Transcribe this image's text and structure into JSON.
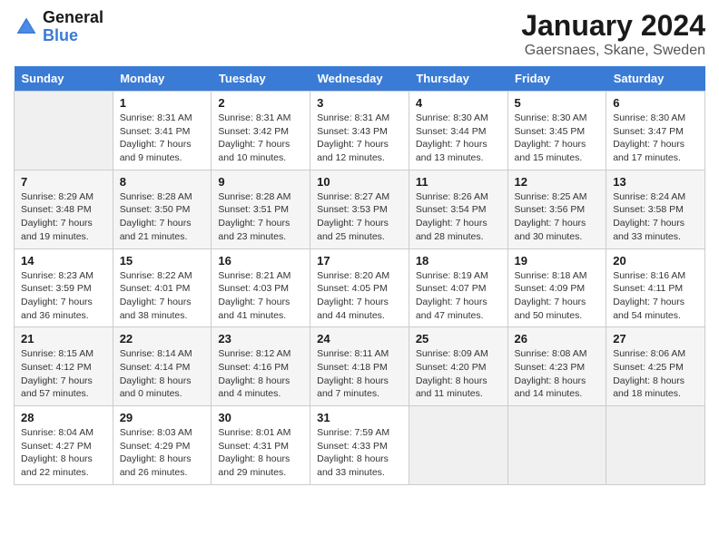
{
  "header": {
    "logo_text_general": "General",
    "logo_text_blue": "Blue",
    "month_title": "January 2024",
    "location": "Gaersnaes, Skane, Sweden"
  },
  "days_of_week": [
    "Sunday",
    "Monday",
    "Tuesday",
    "Wednesday",
    "Thursday",
    "Friday",
    "Saturday"
  ],
  "weeks": [
    [
      {
        "day": "",
        "empty": true
      },
      {
        "day": "1",
        "sunrise": "Sunrise: 8:31 AM",
        "sunset": "Sunset: 3:41 PM",
        "daylight": "Daylight: 7 hours and 9 minutes."
      },
      {
        "day": "2",
        "sunrise": "Sunrise: 8:31 AM",
        "sunset": "Sunset: 3:42 PM",
        "daylight": "Daylight: 7 hours and 10 minutes."
      },
      {
        "day": "3",
        "sunrise": "Sunrise: 8:31 AM",
        "sunset": "Sunset: 3:43 PM",
        "daylight": "Daylight: 7 hours and 12 minutes."
      },
      {
        "day": "4",
        "sunrise": "Sunrise: 8:30 AM",
        "sunset": "Sunset: 3:44 PM",
        "daylight": "Daylight: 7 hours and 13 minutes."
      },
      {
        "day": "5",
        "sunrise": "Sunrise: 8:30 AM",
        "sunset": "Sunset: 3:45 PM",
        "daylight": "Daylight: 7 hours and 15 minutes."
      },
      {
        "day": "6",
        "sunrise": "Sunrise: 8:30 AM",
        "sunset": "Sunset: 3:47 PM",
        "daylight": "Daylight: 7 hours and 17 minutes."
      }
    ],
    [
      {
        "day": "7",
        "sunrise": "Sunrise: 8:29 AM",
        "sunset": "Sunset: 3:48 PM",
        "daylight": "Daylight: 7 hours and 19 minutes."
      },
      {
        "day": "8",
        "sunrise": "Sunrise: 8:28 AM",
        "sunset": "Sunset: 3:50 PM",
        "daylight": "Daylight: 7 hours and 21 minutes."
      },
      {
        "day": "9",
        "sunrise": "Sunrise: 8:28 AM",
        "sunset": "Sunset: 3:51 PM",
        "daylight": "Daylight: 7 hours and 23 minutes."
      },
      {
        "day": "10",
        "sunrise": "Sunrise: 8:27 AM",
        "sunset": "Sunset: 3:53 PM",
        "daylight": "Daylight: 7 hours and 25 minutes."
      },
      {
        "day": "11",
        "sunrise": "Sunrise: 8:26 AM",
        "sunset": "Sunset: 3:54 PM",
        "daylight": "Daylight: 7 hours and 28 minutes."
      },
      {
        "day": "12",
        "sunrise": "Sunrise: 8:25 AM",
        "sunset": "Sunset: 3:56 PM",
        "daylight": "Daylight: 7 hours and 30 minutes."
      },
      {
        "day": "13",
        "sunrise": "Sunrise: 8:24 AM",
        "sunset": "Sunset: 3:58 PM",
        "daylight": "Daylight: 7 hours and 33 minutes."
      }
    ],
    [
      {
        "day": "14",
        "sunrise": "Sunrise: 8:23 AM",
        "sunset": "Sunset: 3:59 PM",
        "daylight": "Daylight: 7 hours and 36 minutes."
      },
      {
        "day": "15",
        "sunrise": "Sunrise: 8:22 AM",
        "sunset": "Sunset: 4:01 PM",
        "daylight": "Daylight: 7 hours and 38 minutes."
      },
      {
        "day": "16",
        "sunrise": "Sunrise: 8:21 AM",
        "sunset": "Sunset: 4:03 PM",
        "daylight": "Daylight: 7 hours and 41 minutes."
      },
      {
        "day": "17",
        "sunrise": "Sunrise: 8:20 AM",
        "sunset": "Sunset: 4:05 PM",
        "daylight": "Daylight: 7 hours and 44 minutes."
      },
      {
        "day": "18",
        "sunrise": "Sunrise: 8:19 AM",
        "sunset": "Sunset: 4:07 PM",
        "daylight": "Daylight: 7 hours and 47 minutes."
      },
      {
        "day": "19",
        "sunrise": "Sunrise: 8:18 AM",
        "sunset": "Sunset: 4:09 PM",
        "daylight": "Daylight: 7 hours and 50 minutes."
      },
      {
        "day": "20",
        "sunrise": "Sunrise: 8:16 AM",
        "sunset": "Sunset: 4:11 PM",
        "daylight": "Daylight: 7 hours and 54 minutes."
      }
    ],
    [
      {
        "day": "21",
        "sunrise": "Sunrise: 8:15 AM",
        "sunset": "Sunset: 4:12 PM",
        "daylight": "Daylight: 7 hours and 57 minutes."
      },
      {
        "day": "22",
        "sunrise": "Sunrise: 8:14 AM",
        "sunset": "Sunset: 4:14 PM",
        "daylight": "Daylight: 8 hours and 0 minutes."
      },
      {
        "day": "23",
        "sunrise": "Sunrise: 8:12 AM",
        "sunset": "Sunset: 4:16 PM",
        "daylight": "Daylight: 8 hours and 4 minutes."
      },
      {
        "day": "24",
        "sunrise": "Sunrise: 8:11 AM",
        "sunset": "Sunset: 4:18 PM",
        "daylight": "Daylight: 8 hours and 7 minutes."
      },
      {
        "day": "25",
        "sunrise": "Sunrise: 8:09 AM",
        "sunset": "Sunset: 4:20 PM",
        "daylight": "Daylight: 8 hours and 11 minutes."
      },
      {
        "day": "26",
        "sunrise": "Sunrise: 8:08 AM",
        "sunset": "Sunset: 4:23 PM",
        "daylight": "Daylight: 8 hours and 14 minutes."
      },
      {
        "day": "27",
        "sunrise": "Sunrise: 8:06 AM",
        "sunset": "Sunset: 4:25 PM",
        "daylight": "Daylight: 8 hours and 18 minutes."
      }
    ],
    [
      {
        "day": "28",
        "sunrise": "Sunrise: 8:04 AM",
        "sunset": "Sunset: 4:27 PM",
        "daylight": "Daylight: 8 hours and 22 minutes."
      },
      {
        "day": "29",
        "sunrise": "Sunrise: 8:03 AM",
        "sunset": "Sunset: 4:29 PM",
        "daylight": "Daylight: 8 hours and 26 minutes."
      },
      {
        "day": "30",
        "sunrise": "Sunrise: 8:01 AM",
        "sunset": "Sunset: 4:31 PM",
        "daylight": "Daylight: 8 hours and 29 minutes."
      },
      {
        "day": "31",
        "sunrise": "Sunrise: 7:59 AM",
        "sunset": "Sunset: 4:33 PM",
        "daylight": "Daylight: 8 hours and 33 minutes."
      },
      {
        "day": "",
        "empty": true
      },
      {
        "day": "",
        "empty": true
      },
      {
        "day": "",
        "empty": true
      }
    ]
  ]
}
